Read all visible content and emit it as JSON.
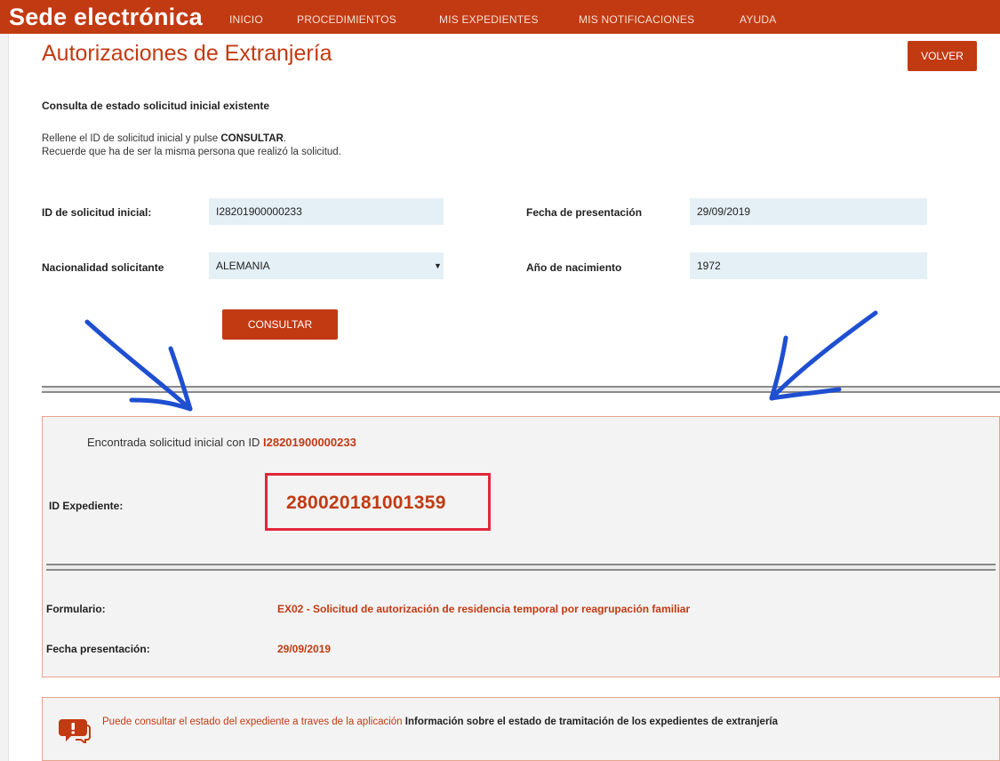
{
  "header": {
    "brand": "Sede electrónica",
    "nav": [
      "INICIO",
      "PROCEDIMIENTOS",
      "MIS EXPEDIENTES",
      "MIS NOTIFICACIONES",
      "AYUDA"
    ]
  },
  "page": {
    "title": "Autorizaciones de Extranjería",
    "back_label": "VOLVER",
    "subtitle": "Consulta de estado solicitud inicial existente",
    "instruction_prefix": "Rellene el ID de solicitud inicial y pulse ",
    "instruction_action": "CONSULTAR",
    "instruction_suffix": ".",
    "instruction_line2": "Recuerde que ha de ser la misma persona que realizó la solicitud."
  },
  "form": {
    "id_label": "ID de solicitud inicial:",
    "id_value": "I28201900000233",
    "date_label": "Fecha de presentación",
    "date_value": "29/09/2019",
    "nationality_label": "Nacionalidad solicitante",
    "nationality_value": "ALEMANIA",
    "birth_year_label": "Año de nacimiento",
    "birth_year_value": "1972",
    "submit_label": "CONSULTAR"
  },
  "result": {
    "found_prefix": "Encontrada solicitud inicial con ID ",
    "found_id": "I28201900000233",
    "expediente_label": "ID Expediente:",
    "expediente_value": "280020181001359",
    "form_label": "Formulario:",
    "form_value": "EX02 - Solicitud de autorización de residencia temporal por reagrupación familiar",
    "presentation_label": "Fecha presentación:",
    "presentation_value": "29/09/2019"
  },
  "info": {
    "text": "Puede consultar el estado del expediente a traves de la aplicación ",
    "link": "Información sobre el estado de tramitación de los expedientes de extranjería"
  },
  "colors": {
    "brand": "#c23a12",
    "field_bg": "#e4f0f6",
    "highlight_border": "#e1263c",
    "annotation_arrow": "#1f4fd1"
  },
  "icons": [
    "chat-warning-icon",
    "dropdown-caret-icon"
  ]
}
